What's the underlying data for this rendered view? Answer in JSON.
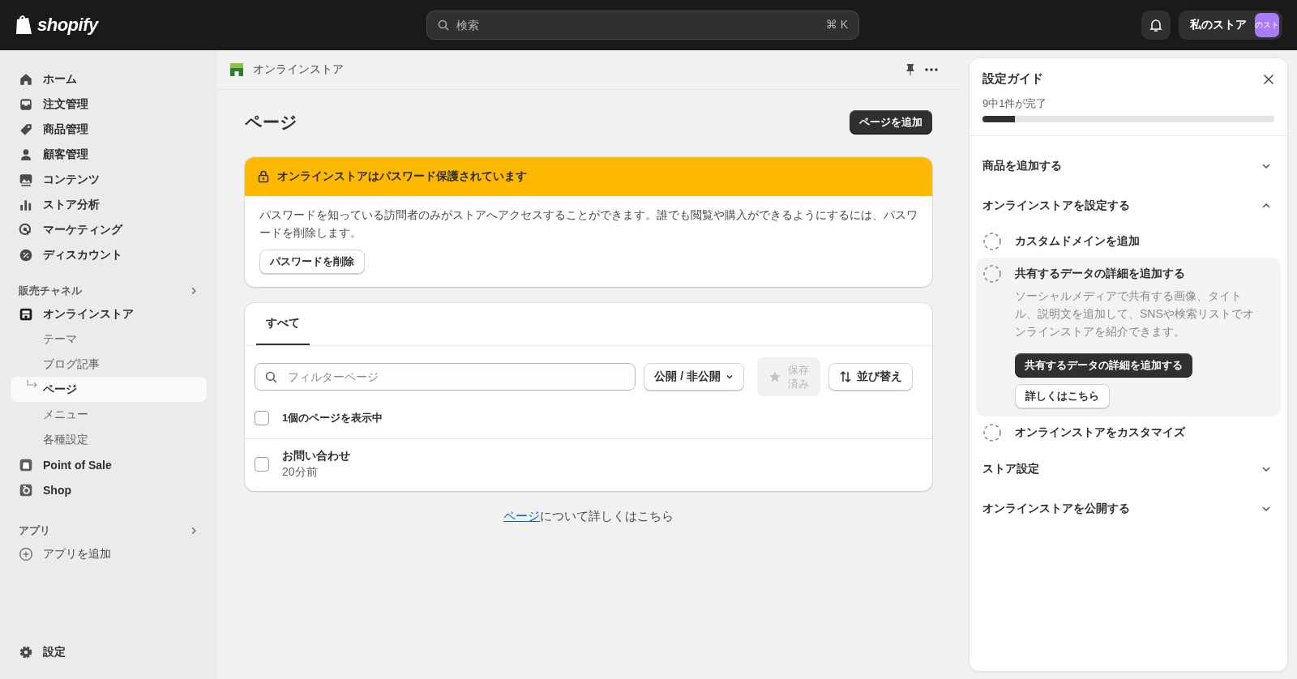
{
  "topbar": {
    "logo": "shopify",
    "search": {
      "placeholder": "検索",
      "shortcut": "⌘ K"
    },
    "store_name": "私のストア",
    "avatar_text": "のスト"
  },
  "sidebar": {
    "main_items": [
      {
        "label": "ホーム",
        "selected": false
      },
      {
        "label": "注文管理",
        "selected": false
      },
      {
        "label": "商品管理",
        "selected": false
      },
      {
        "label": "顧客管理",
        "selected": false
      },
      {
        "label": "コンテンツ",
        "selected": false
      },
      {
        "label": "ストア分析",
        "selected": false
      },
      {
        "label": "マーケティング",
        "selected": false
      },
      {
        "label": "ディスカウント",
        "selected": false
      }
    ],
    "sales_channels": {
      "heading": "販売チャネル",
      "items": [
        {
          "label": "オンラインストア",
          "selected": false,
          "children": [
            {
              "label": "テーマ",
              "selected": false
            },
            {
              "label": "ブログ記事",
              "selected": false
            },
            {
              "label": "ページ",
              "selected": true
            },
            {
              "label": "メニュー",
              "selected": false
            },
            {
              "label": "各種設定",
              "selected": false
            }
          ]
        },
        {
          "label": "Point of Sale",
          "selected": false
        },
        {
          "label": "Shop",
          "selected": false
        }
      ]
    },
    "apps": {
      "heading": "アプリ",
      "items": [
        {
          "label": "アプリを追加"
        }
      ]
    },
    "settings": "設定"
  },
  "breadcrumb": "オンラインストア",
  "page": {
    "title": "ページ",
    "primary_button": "ページを追加",
    "banner": {
      "title": "オンラインストアはパスワード保護されています",
      "body": "パスワードを知っている訪問者のみがストアへアクセスすることができます。誰でも閲覧や購入ができるようにするには、パスワードを削除します。",
      "button": "パスワードを削除"
    },
    "tabs": [
      {
        "label": "すべて",
        "selected": true
      }
    ],
    "filter": {
      "placeholder": "フィルターページ"
    },
    "status_filter": "公開 / 非公開",
    "saved_button": {
      "label": "保存済み",
      "disabled": true
    },
    "sort_button": "並び替え",
    "list_header": {
      "label": "1個のページを表示中",
      "checked": false
    },
    "rows": [
      {
        "title": "お問い合わせ",
        "subtitle": "20分前",
        "checked": false
      }
    ],
    "footer": {
      "link": "ページ",
      "text": "について詳しくはこちら"
    }
  },
  "guide": {
    "title": "設定ガイド",
    "progress_text": "9中1件が完了",
    "level": 0.11,
    "sections": [
      {
        "title": "商品を追加する",
        "expanded": false
      },
      {
        "title": "オンラインストアを設定する",
        "expanded": true,
        "tasks": [
          {
            "title": "カスタムドメインを追加",
            "done": false,
            "expanded": false
          },
          {
            "title": "共有するデータの詳細を追加する",
            "done": false,
            "expanded": true,
            "description": "ソーシャルメディアで共有する画像、タイトル、説明文を追加して、SNSや検索リストでオンラインストアを紹介できます。",
            "primary": "共有するデータの詳細を追加する",
            "secondary": "詳しくはこちら"
          },
          {
            "title": "オンラインストアをカスタマイズ",
            "done": false,
            "expanded": false
          }
        ]
      },
      {
        "title": "ストア設定",
        "expanded": false
      },
      {
        "title": "オンラインストアを公開する",
        "expanded": false
      }
    ]
  }
}
